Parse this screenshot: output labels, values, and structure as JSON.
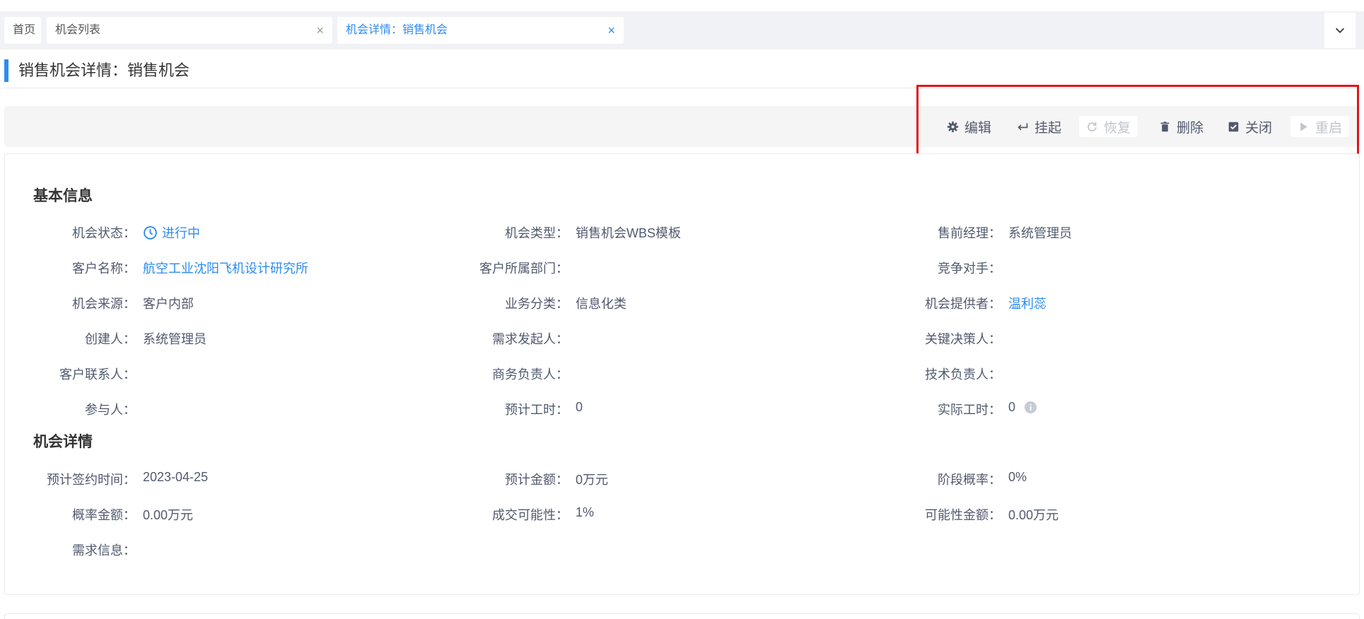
{
  "tabs": [
    {
      "label": "首页"
    },
    {
      "label": "机会列表",
      "close": "×"
    },
    {
      "label": "机会详情：销售机会",
      "close": "×"
    }
  ],
  "page": {
    "title": "销售机会详情：销售机会"
  },
  "toolbar": {
    "edit": "编辑",
    "suspend": "挂起",
    "restore": "恢复",
    "delete": "删除",
    "close": "关闭",
    "restart": "重启"
  },
  "sections": {
    "basic": "基本信息",
    "detail": "机会详情"
  },
  "basic": {
    "status_label": "机会状态：",
    "status_value": "进行中",
    "type_label": "机会类型：",
    "type_value": "销售机会WBS模板",
    "presale_label": "售前经理：",
    "presale_value": "系统管理员",
    "customer_label": "客户名称：",
    "customer_value": "航空工业沈阳飞机设计研究所",
    "dept_label": "客户所属部门：",
    "dept_value": "",
    "competitor_label": "竞争对手：",
    "competitor_value": "",
    "source_label": "机会来源：",
    "source_value": "客户内部",
    "business_label": "业务分类：",
    "business_value": "信息化类",
    "provider_label": "机会提供者：",
    "provider_value": "温利蕊",
    "creator_label": "创建人：",
    "creator_value": "系统管理员",
    "initiator_label": "需求发起人：",
    "initiator_value": "",
    "decision_label": "关键决策人：",
    "decision_value": "",
    "contact_label": "客户联系人：",
    "contact_value": "",
    "commerce_label": "商务负责人：",
    "commerce_value": "",
    "tech_label": "技术负责人：",
    "tech_value": "",
    "participant_label": "参与人：",
    "participant_value": "",
    "est_hours_label": "预计工时：",
    "est_hours_value": "0",
    "act_hours_label": "实际工时：",
    "act_hours_value": "0"
  },
  "detail": {
    "sign_date_label": "预计签约时间：",
    "sign_date_value": "2023-04-25",
    "est_amount_label": "预计金额：",
    "est_amount_value": "0万元",
    "stage_prob_label": "阶段概率：",
    "stage_prob_value": "0%",
    "prob_amount_label": "概率金额：",
    "prob_amount_value": "0.00万元",
    "deal_prob_label": "成交可能性：",
    "deal_prob_value": "1%",
    "possible_amount_label": "可能性金额：",
    "possible_amount_value": "0.00万元",
    "demand_label": "需求信息：",
    "demand_value": ""
  },
  "colors": {
    "accent": "#2d8cf0",
    "highlight": "#e3151a"
  },
  "icons": {
    "edit": "gear-icon",
    "suspend": "return-arrow-icon",
    "restore": "refresh-icon",
    "delete": "trash-icon",
    "close": "checkbox-icon",
    "restart": "play-icon",
    "status": "clock-icon",
    "info": "info-icon",
    "dropdown": "chevron-down-icon"
  }
}
